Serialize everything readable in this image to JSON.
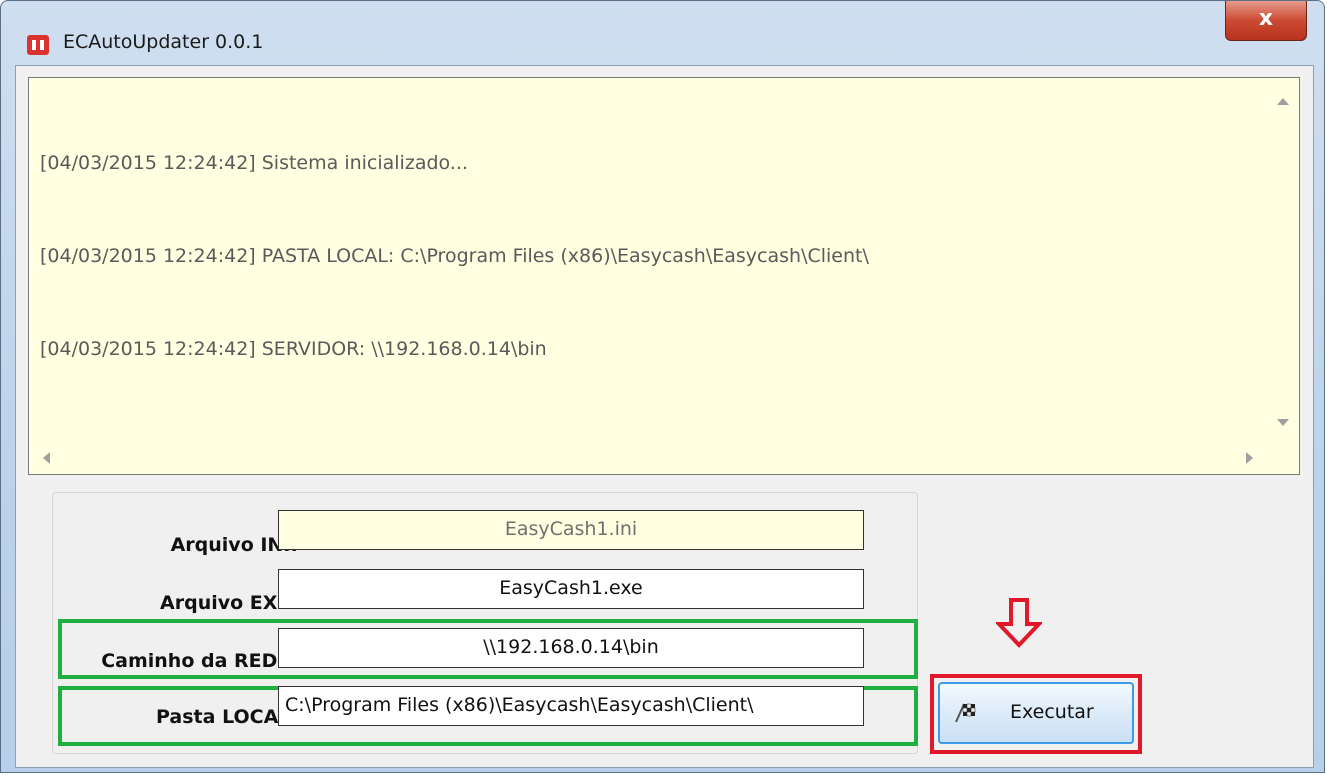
{
  "window": {
    "title": "ECAutoUpdater 0.0.1",
    "close_glyph": "x"
  },
  "log": {
    "lines": [
      "[04/03/2015 12:24:42] Sistema inicializado...",
      "[04/03/2015 12:24:42] PASTA LOCAL: C:\\Program Files (x86)\\Easycash\\Easycash\\Client\\",
      "[04/03/2015 12:24:42] SERVIDOR: \\\\192.168.0.14\\bin"
    ]
  },
  "form": {
    "ini_label": "Arquivo INI:",
    "ini_value": "EasyCash1.ini",
    "exe_label": "Arquivo EXE:",
    "exe_value": "EasyCash1.exe",
    "rede_label": "Caminho da REDE:",
    "rede_value": "\\\\192.168.0.14\\bin",
    "local_label": "Pasta LOCAL:",
    "local_value": "C:\\Program Files (x86)\\Easycash\\Easycash\\Client\\"
  },
  "actions": {
    "execute_label": "Executar"
  },
  "icons": {
    "app": "app-icon",
    "execute": "checkered-flag-icon",
    "annotation": "down-arrow-icon"
  },
  "colors": {
    "log_background": "#ffffe1",
    "highlight_green": "#20b040",
    "highlight_red": "#e2182a",
    "button_border": "#3c9be8"
  }
}
